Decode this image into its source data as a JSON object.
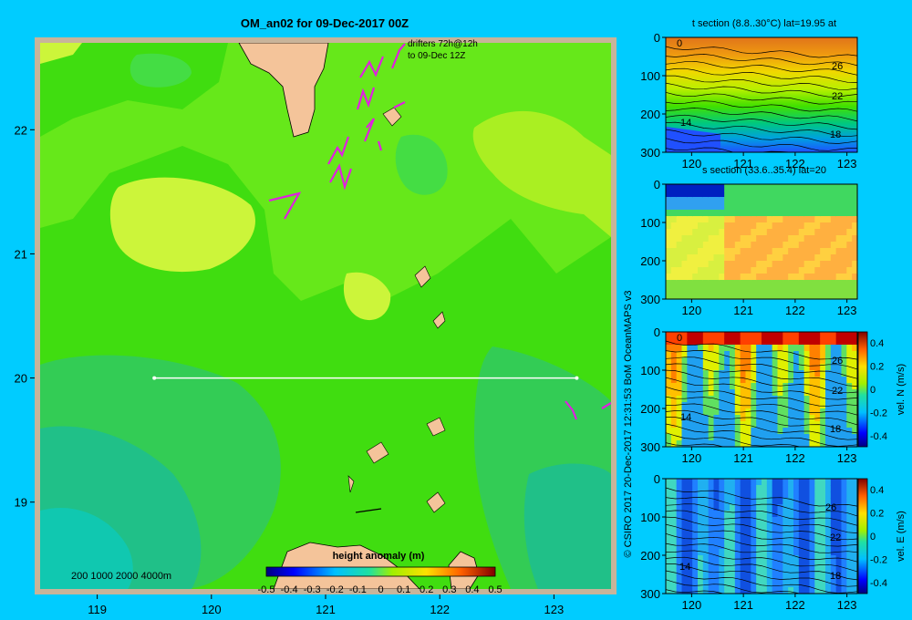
{
  "title": "OM_an02 for 09-Dec-2017 00Z",
  "credit": "© CSIRO 2017   20-Dec-2017 12:31:53 BoM OceanMAPS v3",
  "colors": {
    "background": "#00ccff",
    "land": "#f4c49a",
    "border": "#c8b49a",
    "track": "#ffffff",
    "drifter": "#e020e0"
  },
  "map": {
    "xlim": [
      118.5,
      123.5
    ],
    "ylim": [
      18.3,
      22.7
    ],
    "xticks": [
      "119",
      "120",
      "121",
      "122",
      "123"
    ],
    "yticks": [
      "19",
      "20",
      "21",
      "22"
    ],
    "drifter_label": [
      "drifters 72h@12h",
      "to 09-Dec 12Z"
    ],
    "depth_legend": "200  1000  2000  4000m",
    "colorbar_title": "height anomaly (m)",
    "colorbar_ticks": [
      "-0.5",
      "-0.4",
      "-0.3",
      "-0.2",
      "-0.1",
      "0",
      "0.1",
      "0.2",
      "0.3",
      "0.4",
      "0.5"
    ],
    "section_line": {
      "lon": [
        119.5,
        123.2
      ],
      "lat": [
        20,
        20
      ]
    }
  },
  "panels": [
    {
      "title": "t section (8.8..30°C) lat=19.95 at",
      "kind": "temperature",
      "xticks": [
        "120",
        "121",
        "122",
        "123"
      ],
      "yticks": [
        "0",
        "100",
        "200",
        "300"
      ],
      "contour_labels": [
        "0",
        "26",
        "22",
        "14",
        "18"
      ],
      "cbar": null
    },
    {
      "title": "s section (33.6..35.4) lat=20",
      "kind": "salinity",
      "xticks": [
        "120",
        "121",
        "122",
        "123"
      ],
      "yticks": [
        "0",
        "100",
        "200",
        "300"
      ],
      "contour_labels": [],
      "cbar": null
    },
    {
      "title": "",
      "kind": "velN",
      "xticks": [
        "120",
        "121",
        "122",
        "123"
      ],
      "yticks": [
        "0",
        "100",
        "200",
        "300"
      ],
      "contour_labels": [
        "0",
        "26",
        "22",
        "14",
        "18"
      ],
      "cbar": {
        "label": "vel. N (m/s)",
        "ticks": [
          "0.4",
          "0.2",
          "0",
          "-0.2",
          "-0.4"
        ]
      }
    },
    {
      "title": "",
      "kind": "velE",
      "xticks": [
        "120",
        "121",
        "122",
        "123"
      ],
      "yticks": [
        "0",
        "100",
        "200",
        "300"
      ],
      "contour_labels": [
        "26",
        "22",
        "14",
        "18"
      ],
      "cbar": {
        "label": "vel. E (m/s)",
        "ticks": [
          "0.4",
          "0.2",
          "0",
          "-0.2",
          "-0.4"
        ]
      }
    }
  ],
  "chart_data": {
    "type": "heatmap",
    "title": "OM_an02 for 09-Dec-2017 00Z",
    "colorbar_label": "height anomaly (m)",
    "clim": [
      -0.5,
      0.5
    ],
    "xlim": [
      118.5,
      123.5
    ],
    "ylim": [
      18.3,
      22.7
    ],
    "drifters": "72h@12h to 09-Dec 12Z",
    "section_lat": 20,
    "sections": [
      {
        "name": "t section",
        "range": "8.8..30°C",
        "lat": 19.95,
        "xlim": [
          119.5,
          123.2
        ],
        "ylim": [
          300,
          0
        ]
      },
      {
        "name": "s section",
        "range": "33.6..35.4",
        "lat": 20,
        "xlim": [
          119.5,
          123.2
        ],
        "ylim": [
          300,
          0
        ]
      },
      {
        "name": "vel. N (m/s)",
        "clim": [
          -0.4,
          0.4
        ],
        "xlim": [
          119.5,
          123.2
        ],
        "ylim": [
          300,
          0
        ]
      },
      {
        "name": "vel. E (m/s)",
        "clim": [
          -0.4,
          0.4
        ],
        "xlim": [
          119.5,
          123.2
        ],
        "ylim": [
          300,
          0
        ]
      }
    ]
  }
}
